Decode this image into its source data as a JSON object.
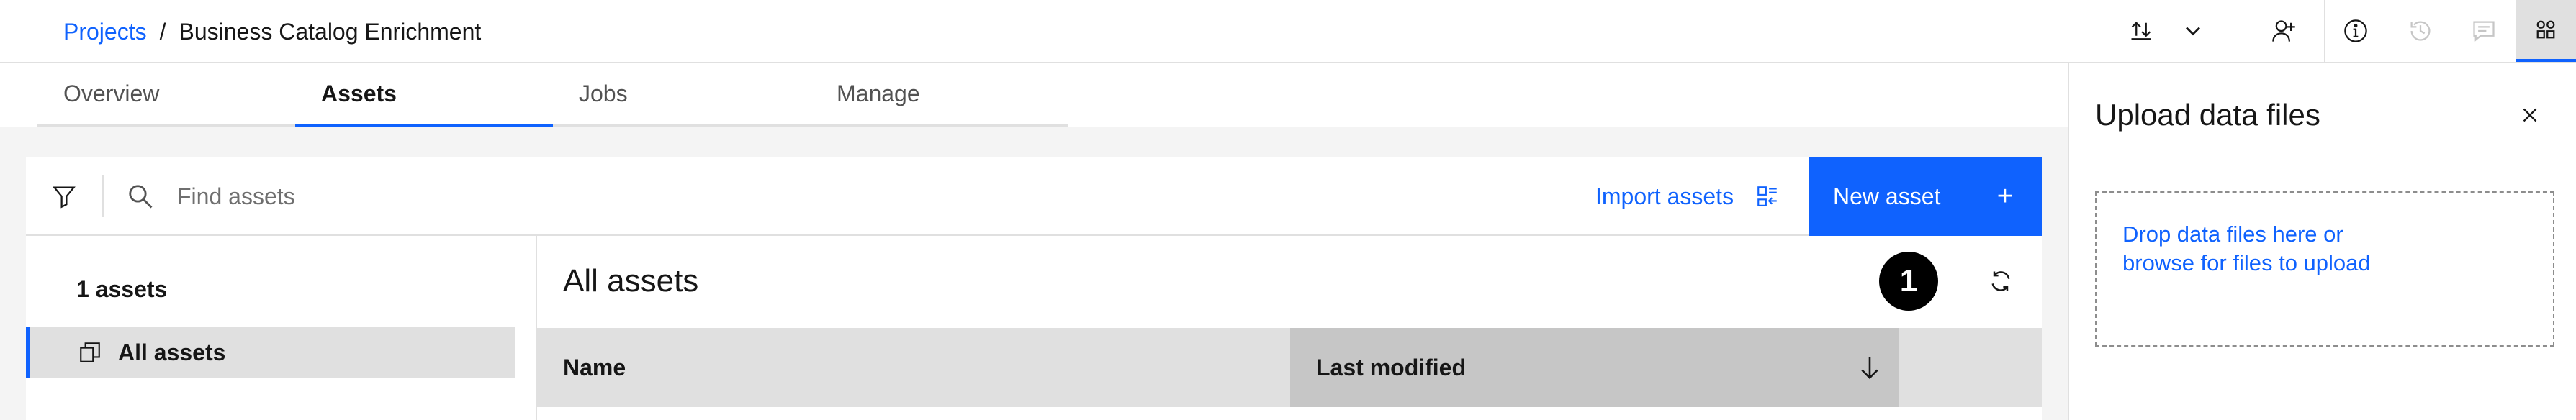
{
  "header": {
    "breadcrumb_link": "Projects",
    "breadcrumb_separator": "/",
    "breadcrumb_current": "Business Catalog Enrichment",
    "icons": [
      "upload-download-icon",
      "chevron-down-icon",
      "add-user-icon",
      "info-icon",
      "history-icon",
      "chat-icon",
      "apps-icon"
    ]
  },
  "tabs": [
    {
      "label": "Overview"
    },
    {
      "label": "Assets",
      "active": true
    },
    {
      "label": "Jobs"
    },
    {
      "label": "Manage"
    }
  ],
  "toolbar": {
    "search_placeholder": "Find assets",
    "import_label": "Import assets",
    "new_asset_label": "New asset",
    "new_asset_icon": "+"
  },
  "sidebar": {
    "count_label": "1 assets",
    "items": [
      {
        "label": "All assets"
      }
    ]
  },
  "content": {
    "title": "All assets",
    "step_badge": "1",
    "columns": [
      {
        "label": "Name"
      },
      {
        "label": "Last modified"
      }
    ]
  },
  "upload_panel": {
    "title": "Upload data files",
    "drop_line1": "Drop data files here or",
    "drop_line2": "browse for files to upload"
  },
  "colors": {
    "accent": "#0f62fe",
    "text": "#161616",
    "muted": "#525252",
    "panel_bg": "#f4f4f4",
    "header_bg": "#e0e0e0"
  }
}
